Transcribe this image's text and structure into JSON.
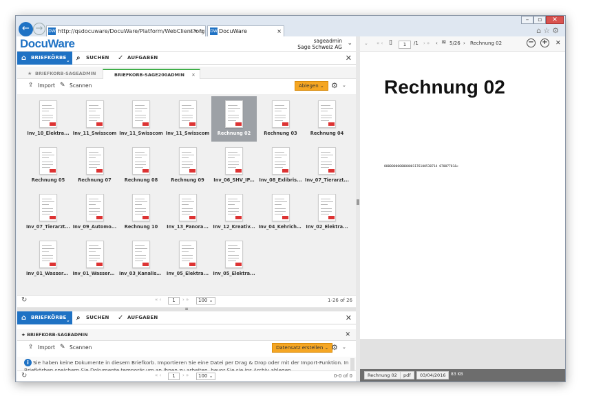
{
  "browser": {
    "address": "http://qsdocuware/DocuWare/Platform/WebClient?orgl",
    "address_controls": "⌕ ▾ ↻",
    "tab_label": "DocuWare",
    "favicon_text": "DW"
  },
  "header": {
    "logo": "DocuWare",
    "user_name": "sageadmin",
    "company": "Sage Schweiz AG"
  },
  "nav": {
    "tabs": [
      {
        "label": "BRIEFKÖRBE",
        "icon": "inbox-icon"
      },
      {
        "label": "SUCHEN",
        "icon": "search-icon"
      },
      {
        "label": "AUFGABEN",
        "icon": "check-icon"
      }
    ]
  },
  "trays": {
    "tabs": [
      {
        "label": "BRIEFKORB-SAGEADMIN",
        "selected": false
      },
      {
        "label": "BRIEFKORB-SAGE200ADMIN",
        "selected": true
      }
    ]
  },
  "toolbar": {
    "import_label": "Import",
    "scan_label": "Scannen",
    "action_label": "Ablegen"
  },
  "documents": [
    {
      "name": "Inv_10_Elektra..."
    },
    {
      "name": "Inv_11_Swisscom"
    },
    {
      "name": "Inv_11_Swisscom"
    },
    {
      "name": "Inv_11_Swisscom"
    },
    {
      "name": "Rechnung 02",
      "selected": true
    },
    {
      "name": "Rechnung 03"
    },
    {
      "name": "Rechnung 04"
    },
    {
      "name": "Rechnung 05"
    },
    {
      "name": "Rechnung 07"
    },
    {
      "name": "Rechnung 08"
    },
    {
      "name": "Rechnung 09"
    },
    {
      "name": "Inv_06_SHV_IP..."
    },
    {
      "name": "Inv_08_Exlibris..."
    },
    {
      "name": "Inv_07_Tierarzt..."
    },
    {
      "name": "Inv_07_Tierarzt..."
    },
    {
      "name": "Inv_09_Automo..."
    },
    {
      "name": "Rechnung 10"
    },
    {
      "name": "Inv_13_Panora..."
    },
    {
      "name": "Inv_12_Kreativ..."
    },
    {
      "name": "Inv_04_Kehricht..."
    },
    {
      "name": "Inv_02_Elektra..."
    },
    {
      "name": "Inv_01_Wasserv..."
    },
    {
      "name": "Inv_01_Wasserv..."
    },
    {
      "name": "Inv_03_Kanalisa..."
    },
    {
      "name": "Inv_05_Elektra..."
    },
    {
      "name": "Inv_05_Elektra..."
    }
  ],
  "pager": {
    "page": "1",
    "page_size": "100",
    "count": "1-26 of 26"
  },
  "bottom": {
    "nav": [
      {
        "label": "BRIEFKÖRBE"
      },
      {
        "label": "SUCHEN"
      },
      {
        "label": "AUFGABEN"
      }
    ],
    "tray_label": "BRIEFKORB-SAGEADMIN",
    "import_label": "Import",
    "scan_label": "Scannen",
    "action_label": "Datensatz erstellen",
    "info_text": "Sie haben keine Dokumente in diesem Briefkorb. Importieren Sie eine Datei per Drag & Drop oder mit der Import-Funktion. In Briefkörben speichern Sie Dokumente temporär um an Ihnen zu arbeiten, bevor Sie sie ins Archiv ablegen.",
    "page": "1",
    "page_size": "100",
    "count": "0-0 of 0"
  },
  "viewer": {
    "page": "1",
    "page_total": "/1",
    "doc_index": "5/26",
    "doc_name": "Rechnung 02",
    "doc_title": "Rechnung 02",
    "doc_code": "0000000000000001176100530714 07007781&>",
    "footer": {
      "name": "Rechnung 02",
      "type": "pdf",
      "date": "03/04/2016",
      "size": "83 KB"
    }
  },
  "colors": {
    "accent": "#1f72c4",
    "action": "#f5a623",
    "selected_tab": "#3fae49"
  }
}
